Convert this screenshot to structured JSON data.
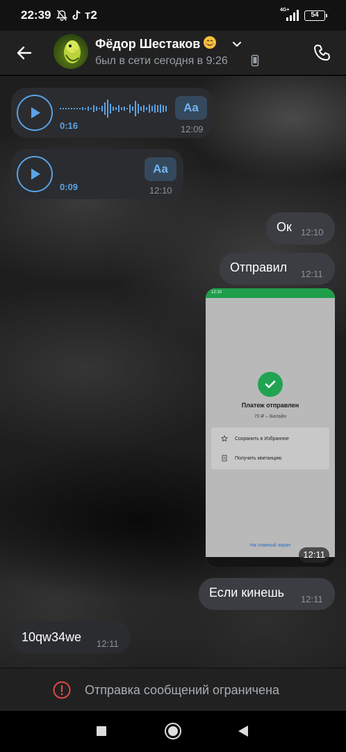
{
  "status_bar": {
    "time": "22:39",
    "carrier": "т2",
    "network_type": "4G+",
    "battery": "54",
    "icons": [
      "notifications-off-icon",
      "tiktok-icon",
      "signal-icon",
      "battery-icon"
    ]
  },
  "header": {
    "contact_name": "Фёдор Шестаков",
    "name_emoji": "smiling-face-icon",
    "last_seen": "был в сети сегодня в 9:26",
    "icons": [
      "back-arrow-icon",
      "chevron-down-icon",
      "phone-small-icon",
      "call-icon"
    ]
  },
  "messages": [
    {
      "type": "voice",
      "direction": "in",
      "duration": "0:16",
      "time": "12:09",
      "transcribe_label": "Aa",
      "has_waveform": true
    },
    {
      "type": "voice",
      "direction": "in",
      "duration": "0:09",
      "time": "12:10",
      "transcribe_label": "Aa",
      "has_waveform": false
    },
    {
      "type": "text",
      "direction": "out",
      "text": "Ок",
      "time": "12:10"
    },
    {
      "type": "text",
      "direction": "out",
      "text": "Отправил",
      "time": "12:11"
    },
    {
      "type": "image",
      "direction": "out",
      "time": "12:11",
      "screenshot": {
        "status": "12:10",
        "title": "Платеж отправлен",
        "subtitle": "70 ₽ – Билайн",
        "row1": "Сохранить в Избранное",
        "row2": "Получить квитанцию",
        "link": "На главный экран"
      }
    },
    {
      "type": "text",
      "direction": "out",
      "text": "Если кинешь",
      "time": "12:11"
    },
    {
      "type": "text",
      "direction": "in",
      "text": "10qw34we",
      "time": "12:11"
    }
  ],
  "restricted": {
    "text": "Отправка сообщений ограничена",
    "icon": "alert-circle-icon"
  },
  "nav_bar": {
    "icons": [
      "recents-square-icon",
      "home-circle-icon",
      "back-triangle-icon"
    ]
  },
  "colors": {
    "accent": "#5aa3e8",
    "bubble_in": "#2b2c2f",
    "bubble_out": "#3b3d42",
    "alert": "#e04848",
    "payment_green": "#21a353"
  }
}
